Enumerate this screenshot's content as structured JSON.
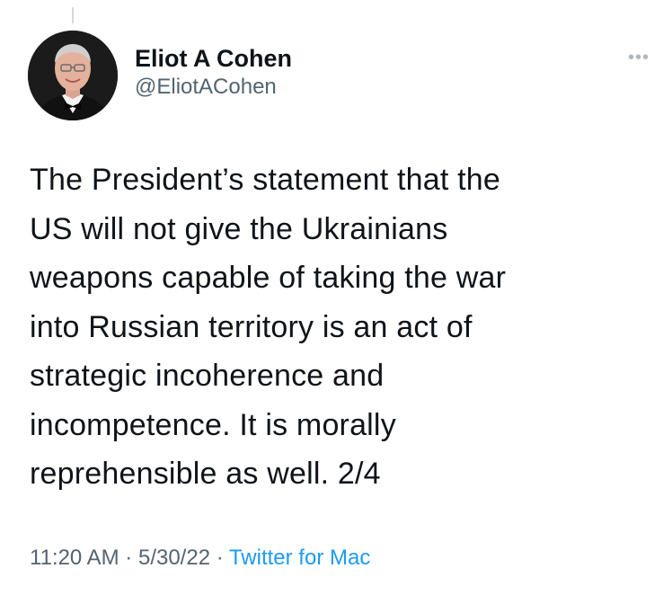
{
  "tweet": {
    "author": {
      "display_name": "Eliot A Cohen",
      "handle": "@EliotACohen"
    },
    "text": "The President’s statement that the\nUS will not give the Ukrainians\nweapons capable of taking the war\ninto Russian territory is an act of\nstrategic incoherence and\nincompetence. It is morally\nreprehensible as well. 2/4",
    "time": "11:20 AM",
    "date": "5/30/22",
    "separator": "·",
    "source": "Twitter for Mac"
  },
  "icons": {
    "more": "more-horizontal-icon",
    "avatar": "profile-photo"
  },
  "colors": {
    "text_primary": "#0f1419",
    "text_secondary": "#536471",
    "link": "#1d9bf0"
  }
}
